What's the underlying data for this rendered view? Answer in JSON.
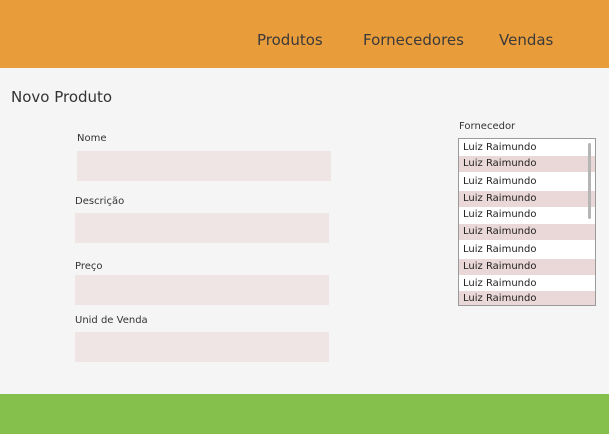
{
  "nav": {
    "items": [
      {
        "label": "Produtos"
      },
      {
        "label": "Fornecedores"
      },
      {
        "label": "Vendas"
      }
    ]
  },
  "page": {
    "title": "Novo Produto"
  },
  "form": {
    "nome": {
      "label": "Nome",
      "value": "",
      "placeholder": ""
    },
    "descricao": {
      "label": "Descrição",
      "value": "",
      "placeholder": ""
    },
    "preco": {
      "label": "Preço",
      "value": "",
      "placeholder": ""
    },
    "unidade": {
      "label": "Unid de Venda",
      "value": "",
      "placeholder": ""
    }
  },
  "supplier": {
    "label": "Fornecedor",
    "options": [
      {
        "label": "Luiz Raimundo"
      },
      {
        "label": "Luiz Raimundo"
      },
      {
        "label": "Luiz Raimundo"
      },
      {
        "label": "Luiz Raimundo"
      },
      {
        "label": "Luiz Raimundo"
      },
      {
        "label": "Luiz Raimundo"
      },
      {
        "label": "Luiz Raimundo"
      },
      {
        "label": "Luiz Raimundo"
      },
      {
        "label": "Luiz Raimundo"
      },
      {
        "label": "Luiz Raimundo"
      }
    ]
  },
  "colors": {
    "header": "#e99c3a",
    "footer": "#86c04c",
    "input_bg": "#efe5e5",
    "row_alt": "#ead7d7",
    "page_bg": "#f5f5f5"
  }
}
